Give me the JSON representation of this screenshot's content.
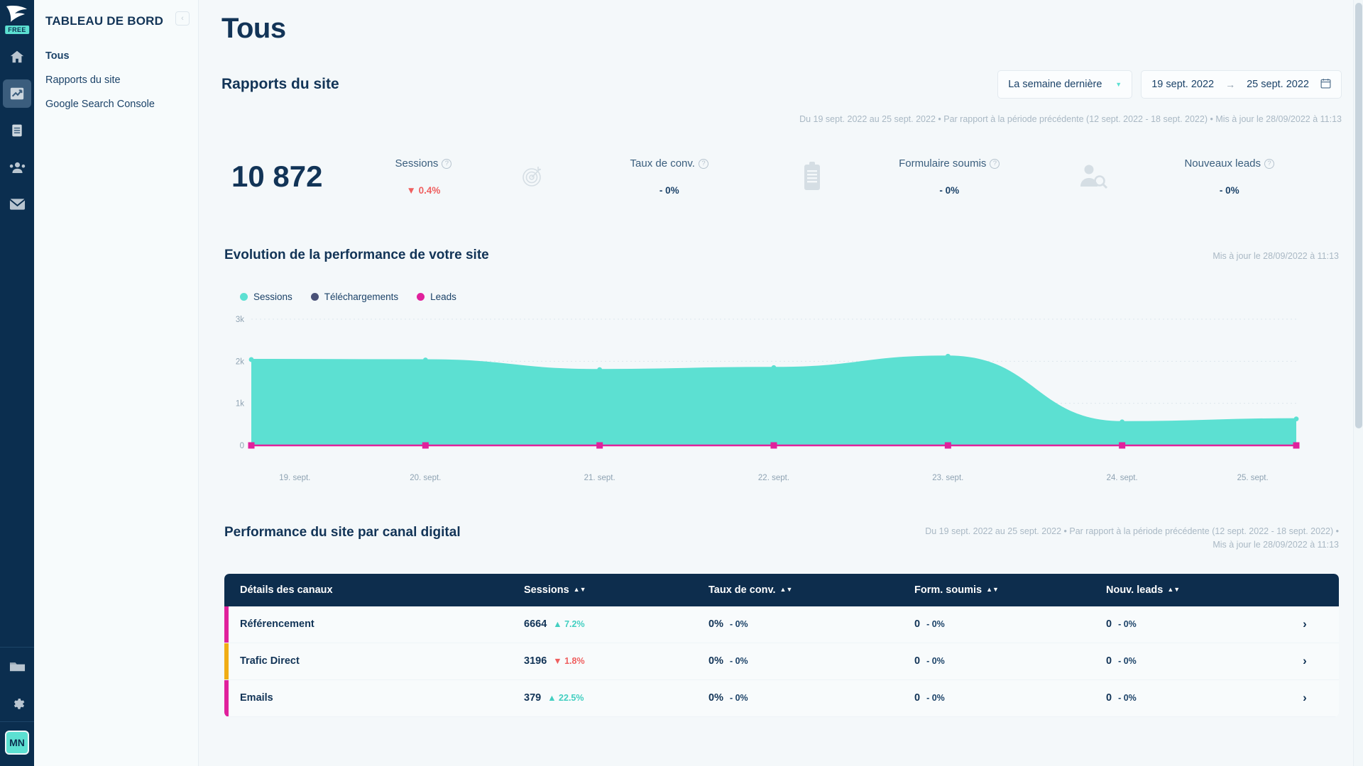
{
  "rail": {
    "logo_name": "plezi-logo",
    "free_badge": "FREE",
    "items": [
      {
        "name": "home-icon",
        "label": "Accueil",
        "active": false
      },
      {
        "name": "chart-icon",
        "label": "Statistiques",
        "active": true
      },
      {
        "name": "document-icon",
        "label": "Contenus",
        "active": false
      },
      {
        "name": "people-icon",
        "label": "Contacts",
        "active": false
      },
      {
        "name": "envelope-icon",
        "label": "Emails",
        "active": false
      }
    ],
    "bottom_items": [
      {
        "name": "folder-icon",
        "label": "Fichiers"
      },
      {
        "name": "gear-icon",
        "label": "Paramètres"
      }
    ],
    "avatar_initials": "MN"
  },
  "sidebar": {
    "title": "TABLEAU DE BORD",
    "collapse_icon": "chevron-left-icon",
    "items": [
      {
        "label": "Tous",
        "active": true
      },
      {
        "label": "Rapports du site",
        "active": false
      },
      {
        "label": "Google Search Console",
        "active": false
      }
    ]
  },
  "page": {
    "title": "Tous",
    "section_title": "Rapports du site",
    "period_select": "La semaine dernière",
    "date_start": "19 sept. 2022",
    "date_end": "25 sept. 2022",
    "date_arrow": "→",
    "calendar_icon": "calendar-icon",
    "meta": "Du 19 sept. 2022 au 25 sept. 2022 • Par rapport à la période précédente (12 sept. 2022 - 18 sept. 2022) • Mis à jour le 28/09/2022 à 11:13"
  },
  "kpis": [
    {
      "label": "Sessions",
      "value": "10 872",
      "delta": "0.4%",
      "delta_dir": "down",
      "delta_symbol": "▼",
      "icon": "sessions-icon",
      "help_icon": "help-icon"
    },
    {
      "label": "Taux de conv.",
      "value": "",
      "delta": "- 0%",
      "delta_dir": "flat",
      "delta_symbol": "",
      "icon": "target-icon",
      "help_icon": "help-icon"
    },
    {
      "label": "Formulaire soumis",
      "value": "",
      "delta": "- 0%",
      "delta_dir": "flat",
      "delta_symbol": "",
      "icon": "clipboard-icon",
      "help_icon": "help-icon"
    },
    {
      "label": "Nouveaux leads",
      "value": "",
      "delta": "- 0%",
      "delta_dir": "flat",
      "delta_symbol": "",
      "icon": "person-search-icon",
      "help_icon": "help-icon"
    }
  ],
  "chart_section": {
    "title": "Evolution de la performance de votre site",
    "updated": "Mis à jour le 28/09/2022 à 11:13"
  },
  "chart_data": {
    "type": "area",
    "title": "Evolution de la performance de votre site",
    "xlabel": "",
    "ylabel": "",
    "ylim": [
      0,
      3000
    ],
    "yticks": [
      0,
      1000,
      2000,
      3000
    ],
    "ytick_labels": [
      "0",
      "1k",
      "2k",
      "3k"
    ],
    "grid": true,
    "legend_position": "top-left",
    "categories": [
      "19. sept.",
      "20. sept.",
      "21. sept.",
      "22. sept.",
      "23. sept.",
      "24. sept.",
      "25. sept."
    ],
    "series": [
      {
        "name": "Sessions",
        "color": "#5ce0d2",
        "values": [
          2040,
          2030,
          1800,
          1850,
          2120,
          560,
          630
        ]
      },
      {
        "name": "Téléchargements",
        "color": "#4a5278",
        "values": [
          0,
          0,
          0,
          0,
          0,
          0,
          0
        ]
      },
      {
        "name": "Leads",
        "color": "#e0219c",
        "values": [
          0,
          0,
          0,
          0,
          0,
          0,
          0
        ]
      }
    ]
  },
  "table_section": {
    "title": "Performance du site par canal digital",
    "meta_line_1": "Du 19 sept. 2022 au 25 sept. 2022 • Par rapport à la période précédente (12 sept. 2022 - 18 sept. 2022) •",
    "meta_line_2": "Mis à jour le 28/09/2022 à 11:13",
    "columns": [
      {
        "label": "Détails des canaux",
        "sortable": false
      },
      {
        "label": "Sessions",
        "sortable": true
      },
      {
        "label": "Taux de conv.",
        "sortable": true
      },
      {
        "label": "Form. soumis",
        "sortable": true
      },
      {
        "label": "Nouv. leads",
        "sortable": true
      }
    ],
    "rows": [
      {
        "channel": "Référencement",
        "bar_color": "#e0219c",
        "sessions": "6664",
        "sessions_delta": "7.2%",
        "sessions_dir": "up",
        "sessions_symbol": "▲",
        "conv": "0%",
        "conv_delta": "- 0%",
        "forms": "0",
        "forms_delta": "- 0%",
        "leads": "0",
        "leads_delta": "- 0%",
        "chevron": "chevron-right-icon"
      },
      {
        "channel": "Trafic Direct",
        "bar_color": "#f0ad15",
        "sessions": "3196",
        "sessions_delta": "1.8%",
        "sessions_dir": "down",
        "sessions_symbol": "▼",
        "conv": "0%",
        "conv_delta": "- 0%",
        "forms": "0",
        "forms_delta": "- 0%",
        "leads": "0",
        "leads_delta": "- 0%",
        "chevron": "chevron-right-icon"
      },
      {
        "channel": "Emails",
        "bar_color": "#e0219c",
        "sessions": "379",
        "sessions_delta": "22.5%",
        "sessions_dir": "up",
        "sessions_symbol": "▲",
        "conv": "0%",
        "conv_delta": "- 0%",
        "forms": "0",
        "forms_delta": "- 0%",
        "leads": "0",
        "leads_delta": "- 0%",
        "chevron": "chevron-right-icon"
      }
    ]
  },
  "colors": {
    "brand_dark": "#0b2e4f",
    "accent_teal": "#5ce0d2",
    "accent_magenta": "#e0219c",
    "accent_purple": "#4a5278",
    "accent_yellow": "#f0ad15",
    "danger": "#ef5f5f",
    "page_bg": "#f4f8fa"
  }
}
